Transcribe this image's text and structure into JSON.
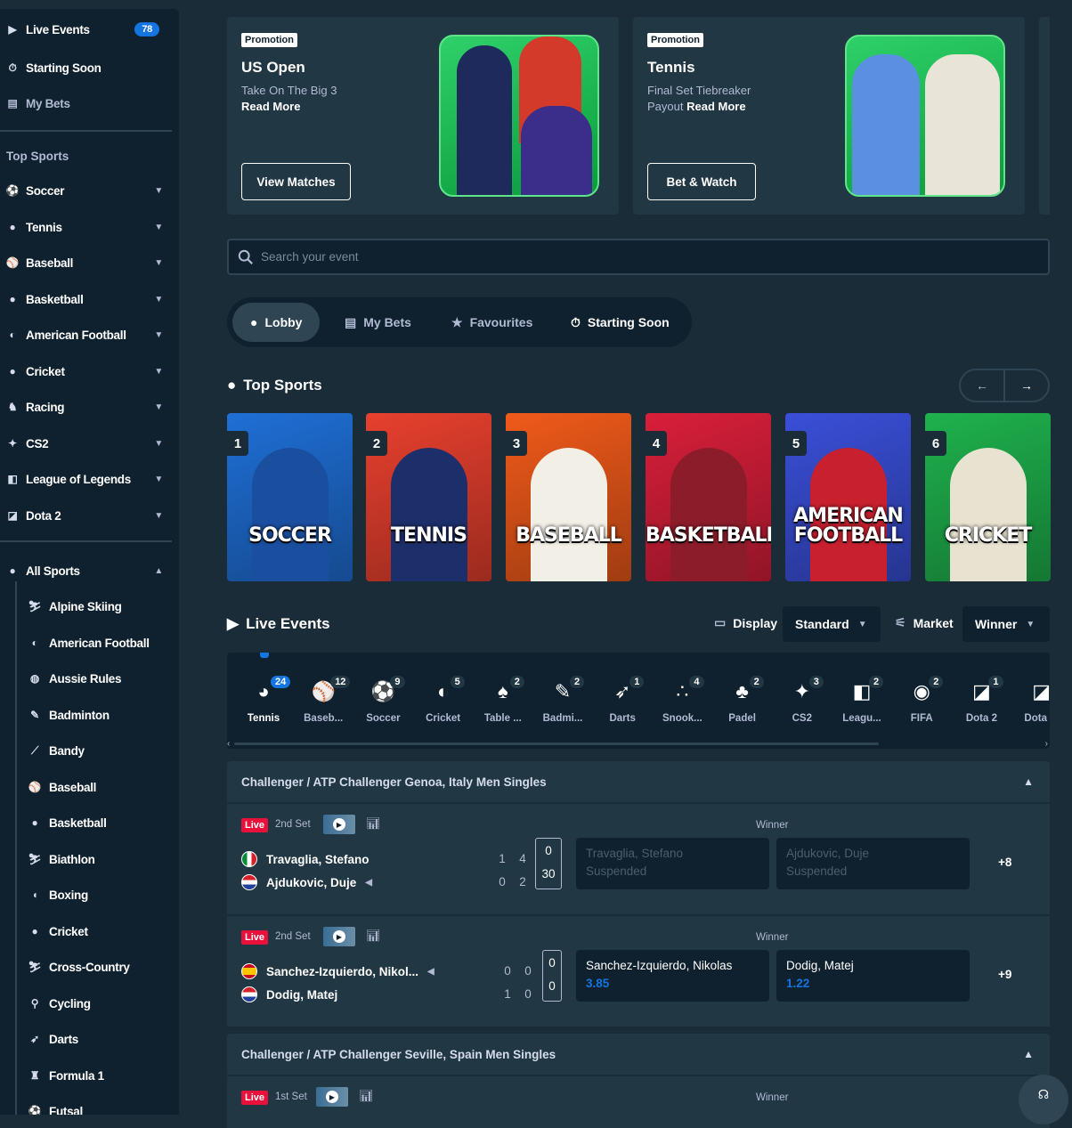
{
  "sidebar": {
    "live_events": "Live Events",
    "live_count": "78",
    "starting_soon": "Starting Soon",
    "my_bets": "My Bets",
    "top_sports_heading": "Top Sports",
    "top_sports": [
      "Soccer",
      "Tennis",
      "Baseball",
      "Basketball",
      "American Football",
      "Cricket",
      "Racing",
      "CS2",
      "League of Legends",
      "Dota 2"
    ],
    "all_sports": "All Sports",
    "all_sports_list": [
      "Alpine Skiing",
      "American Football",
      "Aussie Rules",
      "Badminton",
      "Bandy",
      "Baseball",
      "Basketball",
      "Biathlon",
      "Boxing",
      "Cricket",
      "Cross-Country",
      "Cycling",
      "Darts",
      "Formula 1",
      "Futsal"
    ]
  },
  "promos": [
    {
      "tag": "Promotion",
      "title": "US Open",
      "line1": "Take On The Big 3",
      "line2_plain": "",
      "line2_bold": "Read More",
      "button": "View Matches"
    },
    {
      "tag": "Promotion",
      "title": "Tennis",
      "line1": "Final Set Tiebreaker",
      "line2_plain": "Payout ",
      "line2_bold": "Read More",
      "button": "Bet & Watch"
    }
  ],
  "search": {
    "placeholder": "Search your event"
  },
  "tabs": [
    "Lobby",
    "My Bets",
    "Favourites",
    "Starting Soon"
  ],
  "top_sports_section": {
    "title": "Top Sports",
    "cards": [
      {
        "rank": "1",
        "label": "SOCCER",
        "bg": "#1f6fd6"
      },
      {
        "rank": "2",
        "label": "TENNIS",
        "bg": "#e8402e"
      },
      {
        "rank": "3",
        "label": "BASEBALL",
        "bg": "#f05a1a"
      },
      {
        "rank": "4",
        "label": "BASKETBALL",
        "bg": "#d91f3a"
      },
      {
        "rank": "5",
        "label": "AMERICAN FOOTBALL",
        "bg": "#3a4fd8"
      },
      {
        "rank": "6",
        "label": "CRICKET",
        "bg": "#1fb24d"
      }
    ]
  },
  "live_section": {
    "title": "Live Events",
    "display_label": "Display",
    "display_value": "Standard",
    "market_label": "Market",
    "market_value": "Winner",
    "sports": [
      {
        "name": "Tennis",
        "count": "24",
        "icon": "tennis-icon"
      },
      {
        "name": "Baseb...",
        "count": "12",
        "icon": "baseball-icon"
      },
      {
        "name": "Soccer",
        "count": "9",
        "icon": "soccer-icon"
      },
      {
        "name": "Cricket",
        "count": "5",
        "icon": "cricket-icon"
      },
      {
        "name": "Table ...",
        "count": "2",
        "icon": "table-tennis-icon"
      },
      {
        "name": "Badmi...",
        "count": "2",
        "icon": "badminton-icon"
      },
      {
        "name": "Darts",
        "count": "1",
        "icon": "darts-icon"
      },
      {
        "name": "Snook...",
        "count": "4",
        "icon": "snooker-icon"
      },
      {
        "name": "Padel",
        "count": "2",
        "icon": "padel-icon"
      },
      {
        "name": "CS2",
        "count": "3",
        "icon": "cs2-icon"
      },
      {
        "name": "Leagu...",
        "count": "2",
        "icon": "league-icon"
      },
      {
        "name": "FIFA",
        "count": "2",
        "icon": "fifa-icon"
      },
      {
        "name": "Dota 2",
        "count": "1",
        "icon": "dota-icon"
      },
      {
        "name": "Dota ...",
        "count": "",
        "icon": "dota-icon"
      }
    ]
  },
  "leagues": [
    {
      "name": "Challenger / ATP Challenger Genoa, Italy Men Singles",
      "matches": [
        {
          "status": "Live",
          "period": "2nd Set",
          "market": "Winner",
          "home": "Travaglia, Stefano",
          "away": "Ajdukovic, Duje",
          "home_sets": [
            "1",
            "4"
          ],
          "away_sets": [
            "0",
            "2"
          ],
          "home_game": "0",
          "away_game": "30",
          "odd1_name": "Travaglia, Stefano",
          "odd1_val": "Suspended",
          "odd2_name": "Ajdukovic, Duje",
          "odd2_val": "Suspended",
          "more": "+8"
        },
        {
          "status": "Live",
          "period": "2nd Set",
          "market": "Winner",
          "home": "Sanchez-Izquierdo, Nikol...",
          "away": "Dodig, Matej",
          "home_sets": [
            "0",
            "0"
          ],
          "away_sets": [
            "1",
            "0"
          ],
          "home_game": "0",
          "away_game": "0",
          "odd1_name": "Sanchez-Izquierdo, Nikolas",
          "odd1_val": "3.85",
          "odd2_name": "Dodig, Matej",
          "odd2_val": "1.22",
          "more": "+9"
        }
      ]
    },
    {
      "name": "Challenger / ATP Challenger Seville, Spain Men Singles",
      "matches": [
        {
          "status": "Live",
          "period": "1st Set",
          "market": "Winner"
        }
      ]
    }
  ],
  "colors": {
    "bg": "#1a2c38",
    "sidebar": "#0f212e",
    "panel": "#213743",
    "accent": "#1475e1",
    "live": "#e9113c"
  }
}
